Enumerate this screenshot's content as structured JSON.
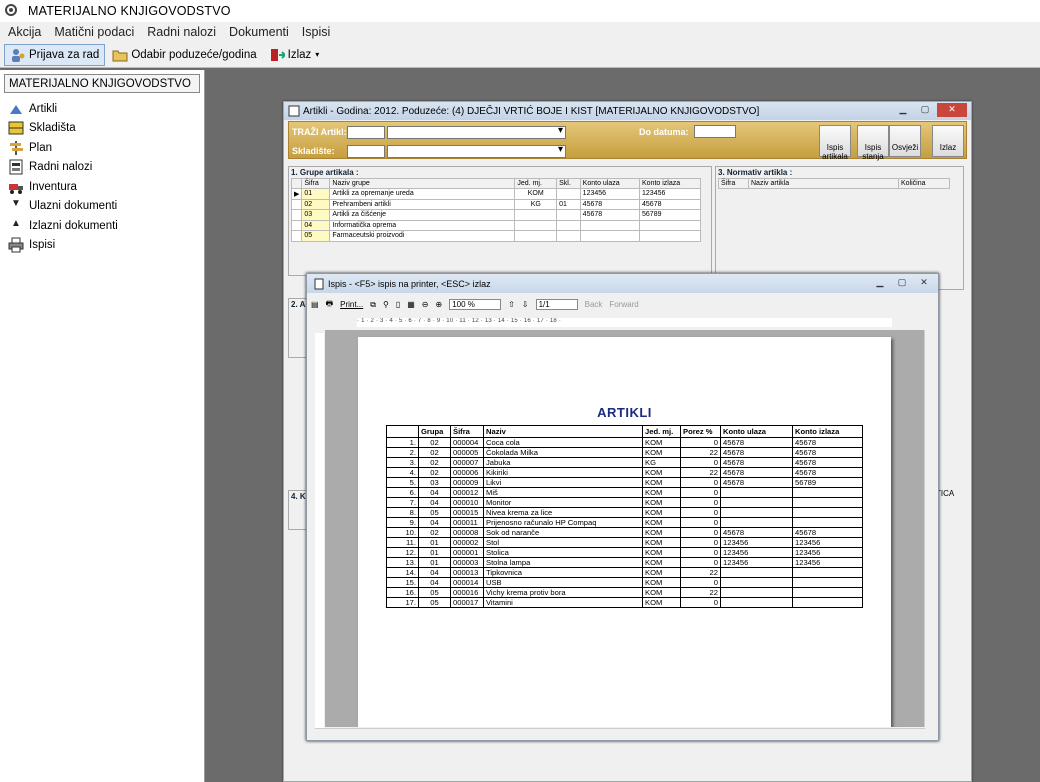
{
  "app": {
    "title": "MATERIJALNO KNJIGOVODSTVO"
  },
  "menu": [
    "Akcija",
    "Matični podaci",
    "Radni nalozi",
    "Dokumenti",
    "Ispisi"
  ],
  "toolbar": {
    "login": "Prijava za rad",
    "select": "Odabir poduzeće/godina",
    "exit": "Izlaz"
  },
  "sidebar": {
    "header": "MATERIJALNO KNJIGOVODSTVO",
    "items": [
      "Artikli",
      "Skladišta",
      "Plan",
      "Radni nalozi",
      "Inventura",
      "Ulazni dokumenti",
      "Izlazni dokumenti",
      "Ispisi"
    ]
  },
  "articles_window": {
    "title": "Artikli -  Godina: 2012.  Poduzeće: (4) DJEČJI VRTIĆ BOJE I KIST  [MATERIJALNO KNJIGOVODSTVO]",
    "search_label": "TRAŽI Artikl:",
    "warehouse_label": "Skladište:",
    "date_label": "Do datuma:",
    "btn_print_articles": "Ispis artikala",
    "btn_print_stock": "Ispis stanja",
    "btn_refresh": "Osvježi",
    "btn_exit": "Izlaz",
    "groups_title": "1. Grupe artikala :",
    "groups_headers": [
      "Šifra",
      "Naziv grupe",
      "Jed. mj.",
      "Skl.",
      "Konto ulaza",
      "Konto izlaza"
    ],
    "groups_rows": [
      [
        "01",
        "Artikli za opremanje ureda",
        "KOM",
        "",
        "123456",
        "123456"
      ],
      [
        "02",
        "Prehrambeni artikli",
        "KG",
        "01",
        "45678",
        "45678"
      ],
      [
        "03",
        "Artikli za čišćenje",
        "",
        "",
        "45678",
        "56789"
      ],
      [
        "04",
        "Informatička oprema",
        "",
        "",
        "",
        ""
      ],
      [
        "05",
        "Farmaceutski proizvodi",
        "",
        "",
        "",
        ""
      ]
    ],
    "norm_title": "3. Normativ artikla :",
    "norm_headers": [
      "Šifra",
      "Naziv artikla",
      "Količina"
    ],
    "pane2_label": "2. A",
    "pane4_label": "4. K",
    "right_stub": "TICA"
  },
  "print_window": {
    "title": "Ispis - <F5> ispis na printer, <ESC> izlaz",
    "print_btn": "Print...",
    "zoom": "100 %",
    "page": "1/1",
    "back": "Back",
    "forward": "Forward",
    "ruler": "· 1 · 2 · 3 · 4 · 5 · 6 · 7 · 8 · 9 · 10 · 11 · 12 · 13 · 14 · 15 · 16 · 17 · 18 ·",
    "report_title": "ARTIKLI",
    "headers": [
      "",
      "Grupa",
      "Šifra",
      "Naziv",
      "Jed. mj.",
      "Porez %",
      "Konto ulaza",
      "Konto izlaza"
    ],
    "rows": [
      [
        "1.",
        "02",
        "000004",
        "Coca cola",
        "KOM",
        "0",
        "45678",
        "45678"
      ],
      [
        "2.",
        "02",
        "000005",
        "Čokolada Milka",
        "KOM",
        "22",
        "45678",
        "45678"
      ],
      [
        "3.",
        "02",
        "000007",
        "Jabuka",
        "KG",
        "0",
        "45678",
        "45678"
      ],
      [
        "4.",
        "02",
        "000006",
        "Kikiriki",
        "KOM",
        "22",
        "45678",
        "45678"
      ],
      [
        "5.",
        "03",
        "000009",
        "Likvi",
        "KOM",
        "0",
        "45678",
        "56789"
      ],
      [
        "6.",
        "04",
        "000012",
        "Miš",
        "KOM",
        "0",
        "",
        ""
      ],
      [
        "7.",
        "04",
        "000010",
        "Monitor",
        "KOM",
        "0",
        "",
        ""
      ],
      [
        "8.",
        "05",
        "000015",
        "Nivea krema za lice",
        "KOM",
        "0",
        "",
        ""
      ],
      [
        "9.",
        "04",
        "000011",
        "Prijenosno računalo HP Compaq",
        "KOM",
        "0",
        "",
        ""
      ],
      [
        "10.",
        "02",
        "000008",
        "Sok od naranče",
        "KOM",
        "0",
        "45678",
        "45678"
      ],
      [
        "11.",
        "01",
        "000002",
        "Stol",
        "KOM",
        "0",
        "123456",
        "123456"
      ],
      [
        "12.",
        "01",
        "000001",
        "Stolica",
        "KOM",
        "0",
        "123456",
        "123456"
      ],
      [
        "13.",
        "01",
        "000003",
        "Stolna lampa",
        "KOM",
        "0",
        "123456",
        "123456"
      ],
      [
        "14.",
        "04",
        "000013",
        "Tipkovnica",
        "KOM",
        "22",
        "",
        ""
      ],
      [
        "15.",
        "04",
        "000014",
        "USB",
        "KOM",
        "0",
        "",
        ""
      ],
      [
        "16.",
        "05",
        "000016",
        "Vichy krema protiv bora",
        "KOM",
        "22",
        "",
        ""
      ],
      [
        "17.",
        "05",
        "000017",
        "Vitamini",
        "KOM",
        "0",
        "",
        ""
      ]
    ]
  }
}
